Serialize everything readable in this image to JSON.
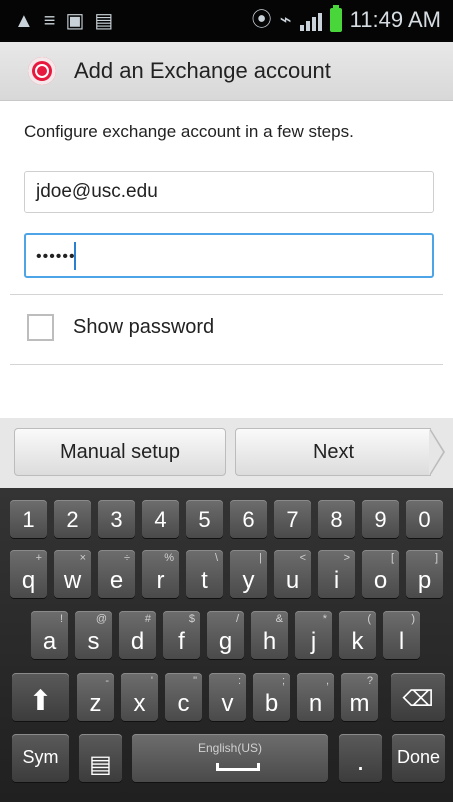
{
  "status_bar": {
    "time": "11:49 AM",
    "icons": [
      "warning-icon",
      "notification-icon",
      "image-icon",
      "photo-icon",
      "signal-icon",
      "wifi-icon",
      "battery-icon"
    ]
  },
  "action_bar": {
    "title": "Add an Exchange account",
    "app_icon": "exchange-icon"
  },
  "form": {
    "description": "Configure exchange account in a few steps.",
    "email_value": "jdoe@usc.edu",
    "password_mask": "••••••",
    "show_password_label": "Show password"
  },
  "buttons": {
    "manual_setup": "Manual setup",
    "next": "Next"
  },
  "keyboard": {
    "numbers": [
      "1",
      "2",
      "3",
      "4",
      "5",
      "6",
      "7",
      "8",
      "9",
      "0"
    ],
    "row_q": [
      {
        "main": "q",
        "sub": "+"
      },
      {
        "main": "w",
        "sub": "×"
      },
      {
        "main": "e",
        "sub": "÷"
      },
      {
        "main": "r",
        "sub": "%"
      },
      {
        "main": "t",
        "sub": "\\"
      },
      {
        "main": "y",
        "sub": "|"
      },
      {
        "main": "u",
        "sub": "<"
      },
      {
        "main": "i",
        "sub": ">"
      },
      {
        "main": "o",
        "sub": "["
      },
      {
        "main": "p",
        "sub": "]"
      }
    ],
    "row_a": [
      {
        "main": "a",
        "sub": "!"
      },
      {
        "main": "s",
        "sub": "@"
      },
      {
        "main": "d",
        "sub": "#"
      },
      {
        "main": "f",
        "sub": "$"
      },
      {
        "main": "g",
        "sub": "/"
      },
      {
        "main": "h",
        "sub": "&"
      },
      {
        "main": "j",
        "sub": "*"
      },
      {
        "main": "k",
        "sub": "("
      },
      {
        "main": "l",
        "sub": ")"
      }
    ],
    "row_z": [
      {
        "main": "z",
        "sub": "-"
      },
      {
        "main": "x",
        "sub": "'"
      },
      {
        "main": "c",
        "sub": "\""
      },
      {
        "main": "v",
        "sub": ":"
      },
      {
        "main": "b",
        "sub": ";"
      },
      {
        "main": "n",
        "sub": ","
      },
      {
        "main": "m",
        "sub": "?"
      }
    ],
    "sym": "Sym",
    "space_label": "English(US)",
    "period": ".",
    "done": "Done",
    "shift_icon": "shift-icon",
    "backspace_icon": "backspace-icon",
    "clipboard_icon": "clipboard-icon"
  }
}
